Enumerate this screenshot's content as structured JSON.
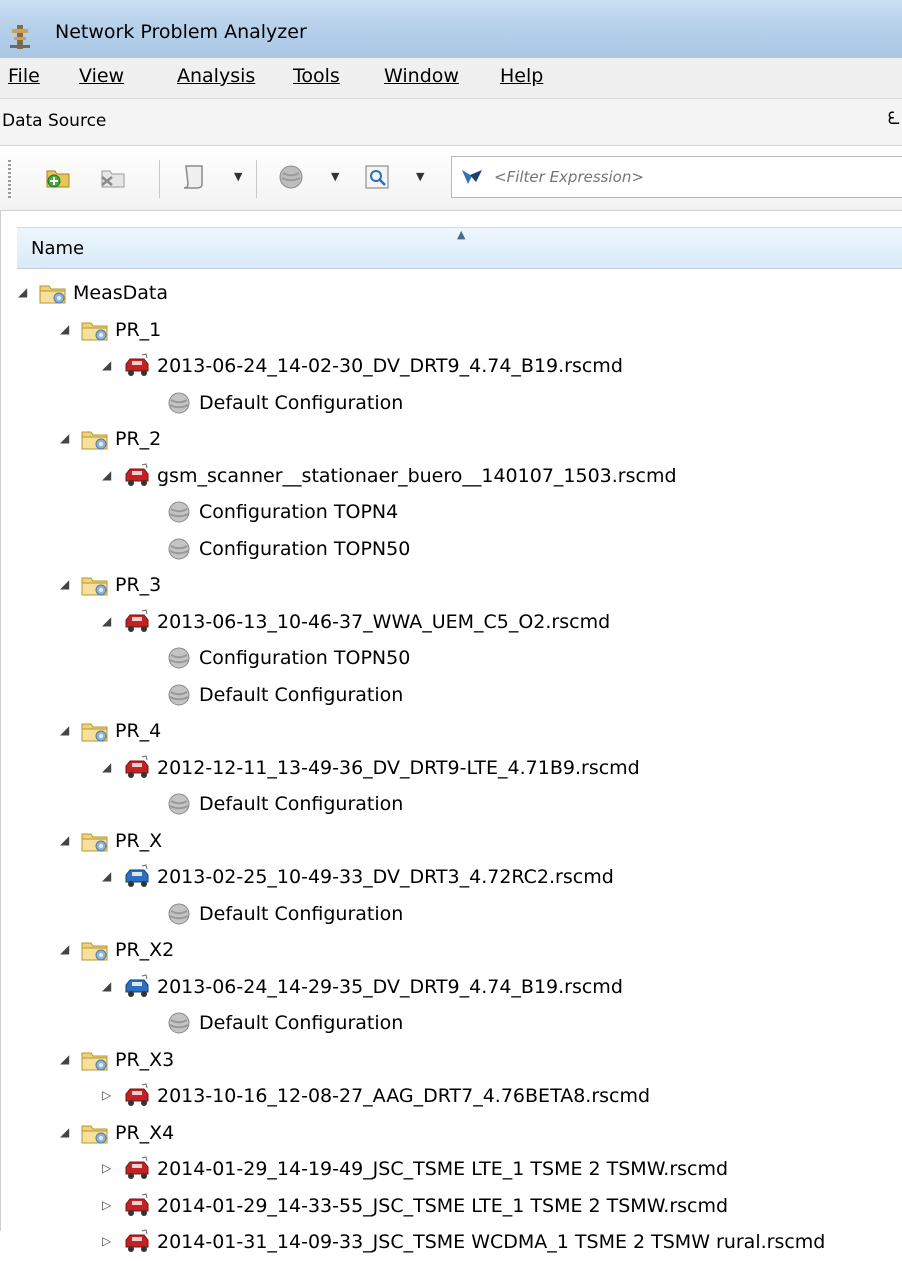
{
  "window": {
    "title": "Network Problem Analyzer"
  },
  "menu": [
    "File",
    "View",
    "Analysis",
    "Tools",
    "Window",
    "Help"
  ],
  "panel": {
    "title": "Data Source",
    "dock_glyph": "ᘍ"
  },
  "toolbar": {
    "filter_placeholder": "<Filter Expression>"
  },
  "tree": {
    "column_header": "Name",
    "rows": [
      {
        "label": "MeasData",
        "level": 0,
        "type": "folder",
        "expanded": true
      },
      {
        "label": "PR_1",
        "level": 1,
        "type": "folder",
        "expanded": true
      },
      {
        "label": "2013-06-24_14-02-30_DV_DRT9_4.74_B19.rscmd",
        "level": 2,
        "type": "car-red",
        "expanded": true
      },
      {
        "label": "Default Configuration",
        "level": 3,
        "type": "config"
      },
      {
        "label": "PR_2",
        "level": 1,
        "type": "folder",
        "expanded": true
      },
      {
        "label": "gsm_scanner__stationaer_buero__140107_1503.rscmd",
        "level": 2,
        "type": "car-red",
        "expanded": true
      },
      {
        "label": "Configuration TOPN4",
        "level": 3,
        "type": "config"
      },
      {
        "label": "Configuration TOPN50",
        "level": 3,
        "type": "config"
      },
      {
        "label": "PR_3",
        "level": 1,
        "type": "folder",
        "expanded": true
      },
      {
        "label": "2013-06-13_10-46-37_WWA_UEM_C5_O2.rscmd",
        "level": 2,
        "type": "car-red",
        "expanded": true
      },
      {
        "label": "Configuration TOPN50",
        "level": 3,
        "type": "config"
      },
      {
        "label": "Default Configuration",
        "level": 3,
        "type": "config"
      },
      {
        "label": "PR_4",
        "level": 1,
        "type": "folder",
        "expanded": true
      },
      {
        "label": "2012-12-11_13-49-36_DV_DRT9-LTE_4.71B9.rscmd",
        "level": 2,
        "type": "car-red",
        "expanded": true
      },
      {
        "label": "Default Configuration",
        "level": 3,
        "type": "config"
      },
      {
        "label": "PR_X",
        "level": 1,
        "type": "folder",
        "expanded": true
      },
      {
        "label": "2013-02-25_10-49-33_DV_DRT3_4.72RC2.rscmd",
        "level": 2,
        "type": "car-blue",
        "expanded": true
      },
      {
        "label": "Default Configuration",
        "level": 3,
        "type": "config"
      },
      {
        "label": "PR_X2",
        "level": 1,
        "type": "folder",
        "expanded": true
      },
      {
        "label": "2013-06-24_14-29-35_DV_DRT9_4.74_B19.rscmd",
        "level": 2,
        "type": "car-blue",
        "expanded": true
      },
      {
        "label": "Default Configuration",
        "level": 3,
        "type": "config"
      },
      {
        "label": "PR_X3",
        "level": 1,
        "type": "folder",
        "expanded": true
      },
      {
        "label": "2013-10-16_12-08-27_AAG_DRT7_4.76BETA8.rscmd",
        "level": 2,
        "type": "car-red",
        "expanded": false
      },
      {
        "label": "PR_X4",
        "level": 1,
        "type": "folder",
        "expanded": true
      },
      {
        "label": "2014-01-29_14-19-49_JSC_TSME LTE_1 TSME 2 TSMW.rscmd",
        "level": 2,
        "type": "car-red",
        "expanded": false
      },
      {
        "label": "2014-01-29_14-33-55_JSC_TSME LTE_1 TSME 2 TSMW.rscmd",
        "level": 2,
        "type": "car-red",
        "expanded": false
      },
      {
        "label": "2014-01-31_14-09-33_JSC_TSME WCDMA_1 TSME 2 TSMW rural.rscmd",
        "level": 2,
        "type": "car-red",
        "expanded": false
      }
    ]
  }
}
